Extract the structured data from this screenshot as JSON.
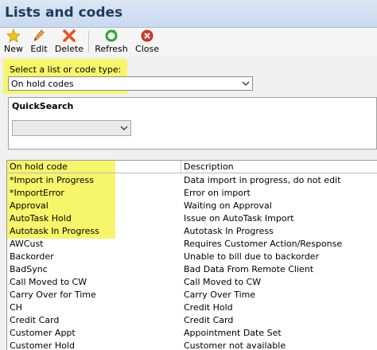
{
  "window": {
    "title": "Lists and codes"
  },
  "toolbar": {
    "new_label": "New",
    "edit_label": "Edit",
    "delete_label": "Delete",
    "refresh_label": "Refresh",
    "close_label": "Close"
  },
  "list_select": {
    "label": "Select a list or code type:",
    "value": "On hold codes"
  },
  "quicksearch": {
    "label": "QuickSearch",
    "value": ""
  },
  "highlight_color": "#f7f56a",
  "table": {
    "columns": [
      "On hold code",
      "Description"
    ],
    "rows": [
      {
        "code": "*Import in Progress",
        "description": "Data import in progress, do not edit"
      },
      {
        "code": "*ImportError",
        "description": "Error on import"
      },
      {
        "code": "Approval",
        "description": "Waiting on Approval"
      },
      {
        "code": "AutoTask Hold",
        "description": "Issue on AutoTask Import"
      },
      {
        "code": "Autotask In Progress",
        "description": "Autotask In Progress"
      },
      {
        "code": "AWCust",
        "description": "Requires Customer Action/Response"
      },
      {
        "code": "Backorder",
        "description": "Unable to bill due to backorder"
      },
      {
        "code": "BadSync",
        "description": "Bad Data From Remote Client"
      },
      {
        "code": "Call Moved to CW",
        "description": "Call Moved to CW"
      },
      {
        "code": "Carry Over for Time",
        "description": "Carry Over Time"
      },
      {
        "code": "CH",
        "description": "Credit Hold"
      },
      {
        "code": "Credit Card",
        "description": "Credit Card"
      },
      {
        "code": "Customer Appt",
        "description": "Appointment Date Set"
      },
      {
        "code": "Customer Hold",
        "description": "Customer not available"
      }
    ]
  }
}
